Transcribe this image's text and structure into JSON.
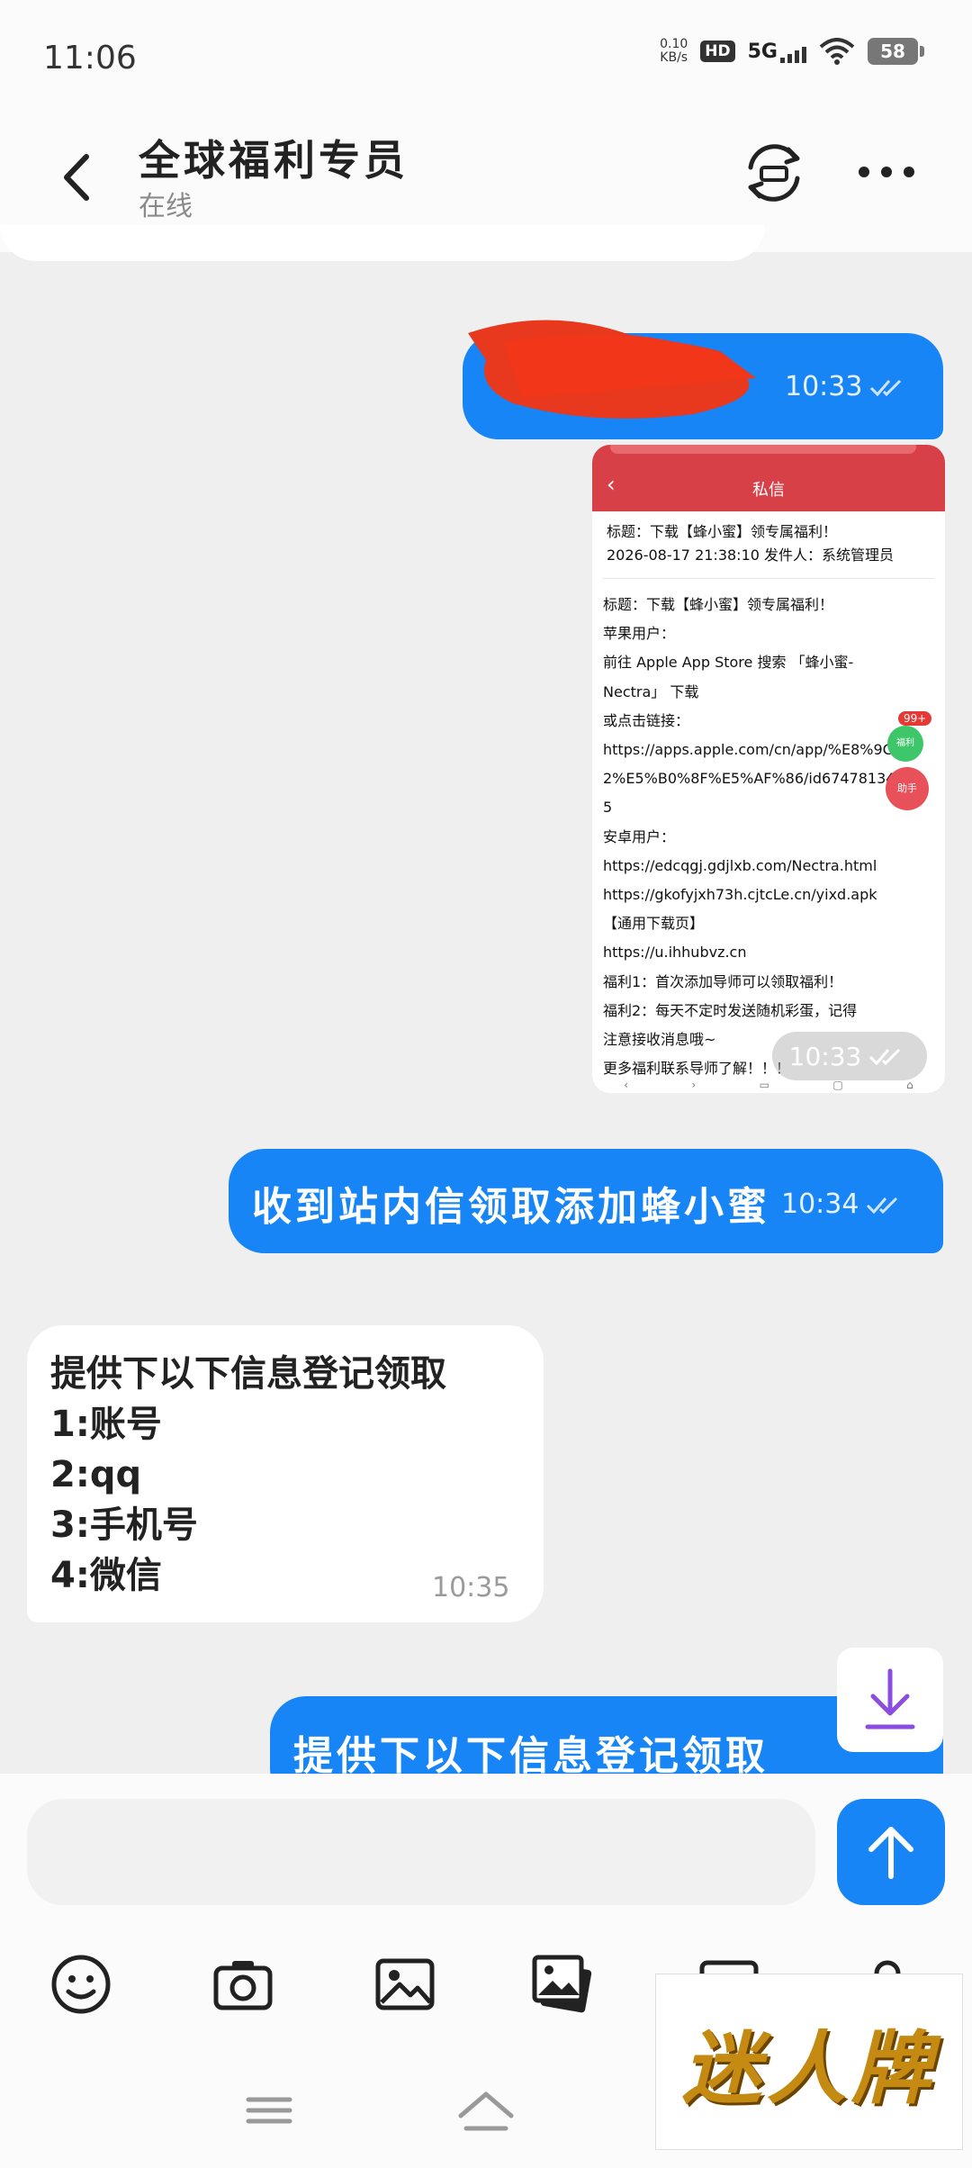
{
  "status_bar": {
    "time": "11:06",
    "net_speed_value": "0.10",
    "net_speed_unit": "KB/s",
    "hd": "HD",
    "network": "5G",
    "battery": "58"
  },
  "header": {
    "title": "全球福利专员",
    "status": "在线"
  },
  "messages": [
    {
      "direction": "out",
      "time": "10:33",
      "redacted": true
    },
    {
      "direction": "out",
      "type": "image",
      "time": "10:33",
      "screenshot": {
        "header_title": "私信",
        "subject": "标题：下载【蜂小蜜】领专属福利！",
        "meta": "2026-08-17 21:38:10   发件人：系统管理员",
        "body_lines": [
          "标题：下载【蜂小蜜】领专属福利！",
          "苹果用户：",
          "前往 Apple App Store 搜索 「蜂小蜜-",
          "Nectra」 下载",
          "或点击链接：",
          "https://apps.apple.com/cn/app/%E8%9C%8",
          "2%E5%B0%8F%E5%AF%86/id67478134",
          "5",
          "安卓用户：",
          "https://edcqgj.gdjlxb.com/Nectra.html",
          "https://gkofyjxh73h.cjtcLe.cn/yixd.apk",
          "【通用下载页】",
          "https://u.ihhubvz.cn",
          "福利1：首次添加导师可以领取福利！",
          "福利2：每天不定时发送随机彩蛋，记得",
          "注意接收消息哦~",
          "更多福利联系导师了解！！！"
        ],
        "badge": "99+",
        "green_btn": "福利",
        "red_btn": "助手"
      }
    },
    {
      "direction": "out",
      "text": "收到站内信领取添加蜂小蜜",
      "time": "10:34"
    },
    {
      "direction": "in",
      "lines": [
        "提供下以下信息登记领取",
        "1:账号",
        "2:qq",
        "3:手机号",
        "4:微信"
      ],
      "time": "10:35"
    },
    {
      "direction": "out",
      "text": "提供下以下信息登记领取",
      "partial": true
    }
  ],
  "composer": {
    "value": "",
    "placeholder": ""
  },
  "toolbar": [
    "emoji-icon",
    "camera-icon",
    "image-icon",
    "gallery-icon",
    "card-icon",
    "location-icon"
  ],
  "watermark": "迷人牌",
  "colors": {
    "bubble_out": "#1785f5",
    "bubble_in": "#ffffff",
    "background": "#efefef",
    "accent_download": "#8a4de0"
  }
}
